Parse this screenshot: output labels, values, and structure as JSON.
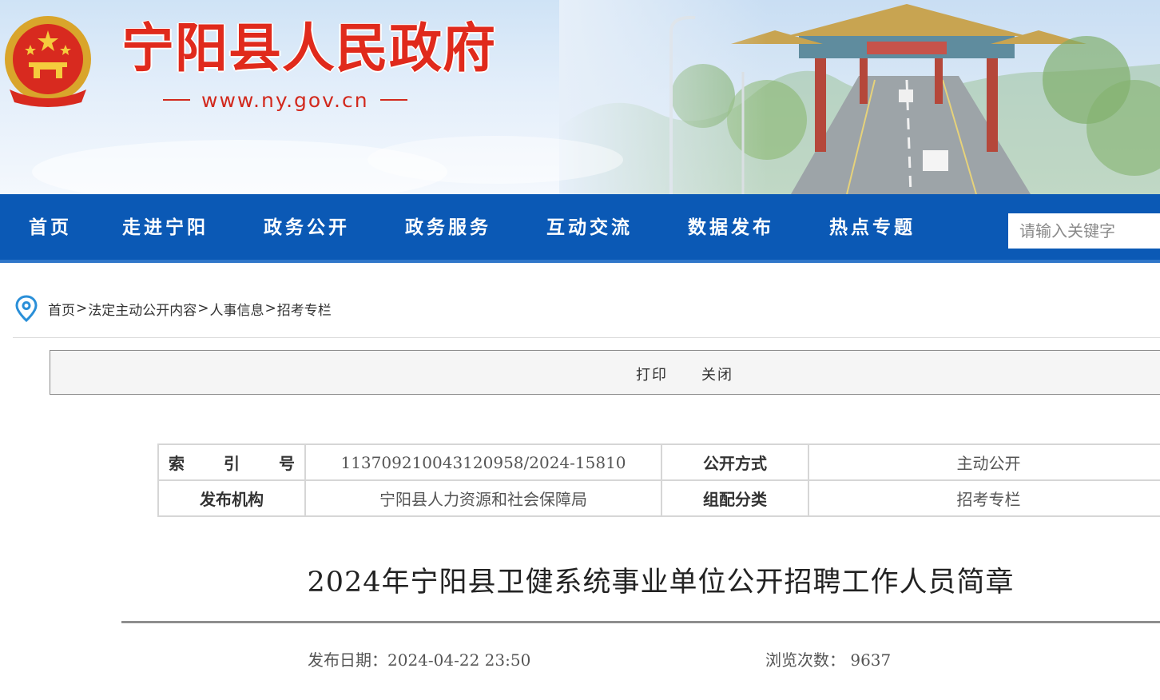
{
  "site": {
    "title": "宁阳县人民政府",
    "url": "www.ny.gov.cn"
  },
  "nav": {
    "items": [
      {
        "label": "首页"
      },
      {
        "label": "走进宁阳"
      },
      {
        "label": "政务公开"
      },
      {
        "label": "政务服务"
      },
      {
        "label": "互动交流"
      },
      {
        "label": "数据发布"
      },
      {
        "label": "热点专题"
      }
    ],
    "search_placeholder": "请输入关键字"
  },
  "breadcrumb": {
    "items": [
      "首页",
      "法定主动公开内容",
      "人事信息",
      "招考专栏"
    ],
    "separator": ">"
  },
  "toolbar": {
    "print_label": "打印",
    "close_label": "关闭"
  },
  "meta": {
    "index_label": [
      "索",
      "引",
      "号"
    ],
    "index_value": "113709210043120958/2024-15810",
    "open_mode_label": "公开方式",
    "open_mode_value": "主动公开",
    "publisher_label": "发布机构",
    "publisher_value": "宁阳县人力资源和社会保障局",
    "category_label": "组配分类",
    "category_value": "招考专栏"
  },
  "article": {
    "title": "2024年宁阳县卫健系统事业单位公开招聘工作人员简章",
    "date_label": "发布日期：",
    "date_value": "2024-04-22 23:50",
    "views_label": "浏览次数：",
    "views_value": "9637"
  },
  "colors": {
    "nav_blue": "#0b59b5",
    "title_red": "#e02a1c",
    "pin_blue": "#2a8fd8"
  },
  "icons": {
    "emblem": "national-emblem-icon",
    "location": "location-pin-icon"
  }
}
